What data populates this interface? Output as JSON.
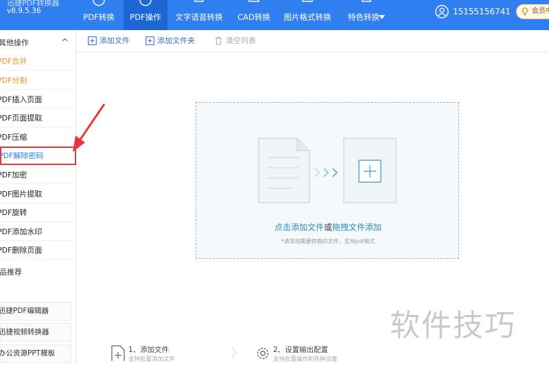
{
  "app": {
    "title": "迅捷PDF转换器",
    "version": "v8.9.5.36"
  },
  "nav": {
    "tabs": [
      {
        "label": "PDF转换",
        "icon": "convert-icon"
      },
      {
        "label": "PDF操作",
        "icon": "operate-icon",
        "active": true
      },
      {
        "label": "文字语音转换",
        "icon": "speech-icon"
      },
      {
        "label": "CAD转换",
        "icon": "cad-icon"
      },
      {
        "label": "图片格式转换",
        "icon": "image-icon"
      },
      {
        "label": "特色转换",
        "icon": "feature-icon"
      }
    ],
    "user_phone": "15155156741",
    "vip_label": "会员中心"
  },
  "sidebar": {
    "section_title": "其他操作",
    "items": [
      {
        "label": "PDF合并"
      },
      {
        "label": "PDF分割"
      },
      {
        "label": "PDF插入页面"
      },
      {
        "label": "PDF页面提取"
      },
      {
        "label": "PDF压缩"
      },
      {
        "label": "PDF解除密码"
      },
      {
        "label": "PDF加密"
      },
      {
        "label": "PDF图片提取"
      },
      {
        "label": "PDF旋转"
      },
      {
        "label": "PDF添加水印"
      },
      {
        "label": "PDF删除页面"
      }
    ],
    "recommend_title": "产品推荐",
    "recommend_items": [
      {
        "label": "迅捷PDF编辑器"
      },
      {
        "label": "迅捷视频转换器"
      },
      {
        "label": "办公资源PPT模板"
      }
    ]
  },
  "toolbar": {
    "add_file": "添加文件",
    "add_folder": "添加文件夹",
    "clear_list": "清空列表"
  },
  "dropzone": {
    "click_add": "点击添加文件",
    "or": "或",
    "drag_add": "拖拽文件添加",
    "hint": "*请添加需要转换的文件，支持pdf格式"
  },
  "steps": [
    {
      "title": "1、添加文件",
      "subtitle": "支持批量添加文件"
    },
    {
      "title": "2、设置输出配置",
      "subtitle": "支持批量操作和各种设置"
    }
  ],
  "watermark": "软件技巧",
  "colors": {
    "topbar": "#2f7ff0",
    "active_tab": "#1c66d6",
    "accent_orange": "#e8932a",
    "highlight_red": "#e03a3a",
    "link_blue": "#2b8bbf"
  }
}
